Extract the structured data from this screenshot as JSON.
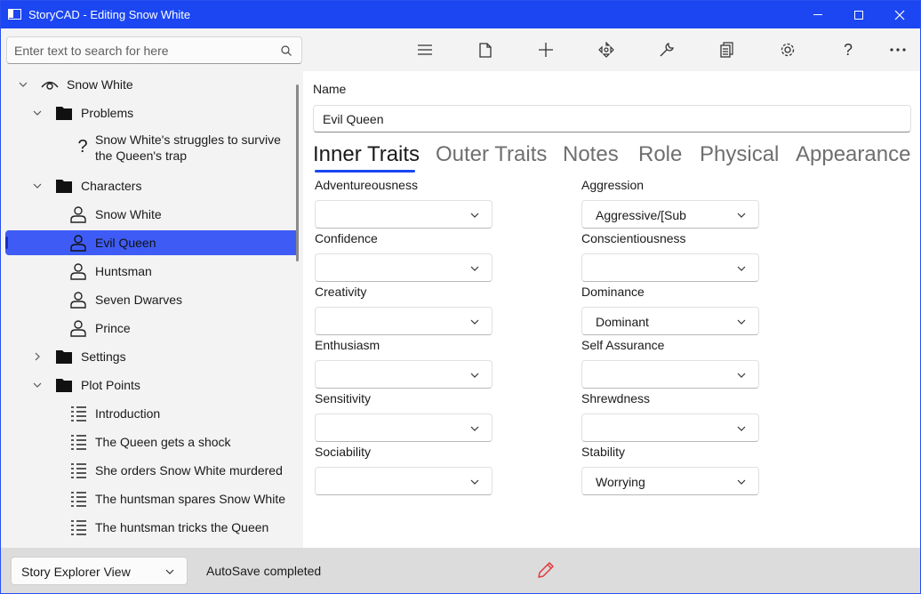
{
  "window": {
    "title": "StoryCAD - Editing Snow White"
  },
  "search": {
    "placeholder": "Enter text to search for here"
  },
  "tree": {
    "items": [
      {
        "label": "Snow White",
        "icon": "eye-icon",
        "level": 0,
        "expanded": true
      },
      {
        "label": "Problems",
        "icon": "folder-icon",
        "level": 1,
        "expanded": true
      },
      {
        "label": "Snow White's struggles to survive the Queen's trap",
        "icon": "question-icon",
        "level": 2
      },
      {
        "label": "Characters",
        "icon": "folder-icon",
        "level": 1,
        "expanded": true
      },
      {
        "label": "Snow White",
        "icon": "person-icon",
        "level": 2
      },
      {
        "label": "Evil Queen",
        "icon": "person-icon",
        "level": 2,
        "selected": true
      },
      {
        "label": "Huntsman",
        "icon": "person-icon",
        "level": 2
      },
      {
        "label": "Seven Dwarves",
        "icon": "person-icon",
        "level": 2
      },
      {
        "label": "Prince",
        "icon": "person-icon",
        "level": 2
      },
      {
        "label": "Settings",
        "icon": "folder-icon",
        "level": 1,
        "expanded": false
      },
      {
        "label": "Plot Points",
        "icon": "folder-icon",
        "level": 1,
        "expanded": true
      },
      {
        "label": "Introduction",
        "icon": "list-icon",
        "level": 2
      },
      {
        "label": "The Queen gets a shock",
        "icon": "list-icon",
        "level": 2
      },
      {
        "label": "She orders Snow White murdered",
        "icon": "list-icon",
        "level": 2
      },
      {
        "label": "The huntsman spares Snow White",
        "icon": "list-icon",
        "level": 2
      },
      {
        "label": "The huntsman tricks the Queen",
        "icon": "list-icon",
        "level": 2
      }
    ]
  },
  "toolbar": {
    "buttons": [
      "menu-icon",
      "file-icon",
      "add-icon",
      "move-icon",
      "wrench-icon",
      "copy-icon",
      "gear-icon",
      "help-icon",
      "more-icon"
    ]
  },
  "form": {
    "name_label": "Name",
    "name_value": "Evil Queen",
    "tabs": [
      "Inner Traits",
      "Outer Traits",
      "Notes",
      "Role",
      "Physical",
      "Appearance"
    ],
    "active_tab": "Inner Traits",
    "left_fields": [
      {
        "label": "Adventureousness",
        "value": ""
      },
      {
        "label": "Confidence",
        "value": ""
      },
      {
        "label": "Creativity",
        "value": ""
      },
      {
        "label": "Enthusiasm",
        "value": ""
      },
      {
        "label": "Sensitivity",
        "value": ""
      },
      {
        "label": "Sociability",
        "value": ""
      }
    ],
    "right_fields": [
      {
        "label": "Aggression",
        "value": "Aggressive/[Sub"
      },
      {
        "label": "Conscientiousness",
        "value": ""
      },
      {
        "label": "Dominance",
        "value": "Dominant"
      },
      {
        "label": "Self Assurance",
        "value": ""
      },
      {
        "label": "Shrewdness",
        "value": ""
      },
      {
        "label": "Stability",
        "value": "Worrying"
      }
    ]
  },
  "statusbar": {
    "view_select": "Story Explorer View",
    "status": "AutoSave completed"
  },
  "colors": {
    "titlebar": "#1b46f2",
    "selection": "#3e5cf5",
    "accent": "#1b46f2",
    "edit_pencil": "#e5383b"
  }
}
